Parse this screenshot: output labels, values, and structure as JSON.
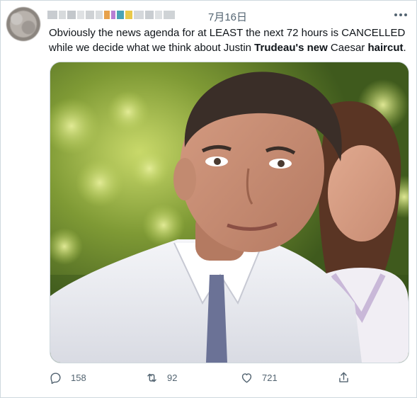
{
  "tweet": {
    "timestamp": "7月16日",
    "text_segments": [
      {
        "text": "Obviously the news agenda for at LEAST the next 72 hours is CANCELLED while we decide what we think about Justin ",
        "bold": false
      },
      {
        "text": "Trudeau's new",
        "bold": true
      },
      {
        "text": " Caesar ",
        "bold": false
      },
      {
        "text": "haircut",
        "bold": true
      },
      {
        "text": ".",
        "bold": false
      }
    ]
  },
  "actions": {
    "reply": {
      "icon": "reply-icon",
      "count": "158"
    },
    "retweet": {
      "icon": "retweet-icon",
      "count": "92"
    },
    "like": {
      "icon": "heart-icon",
      "count": "721"
    },
    "share": {
      "icon": "share-icon"
    }
  },
  "colors": {
    "text": "#0f1419",
    "muted": "#536471",
    "border": "#cfd9de"
  }
}
